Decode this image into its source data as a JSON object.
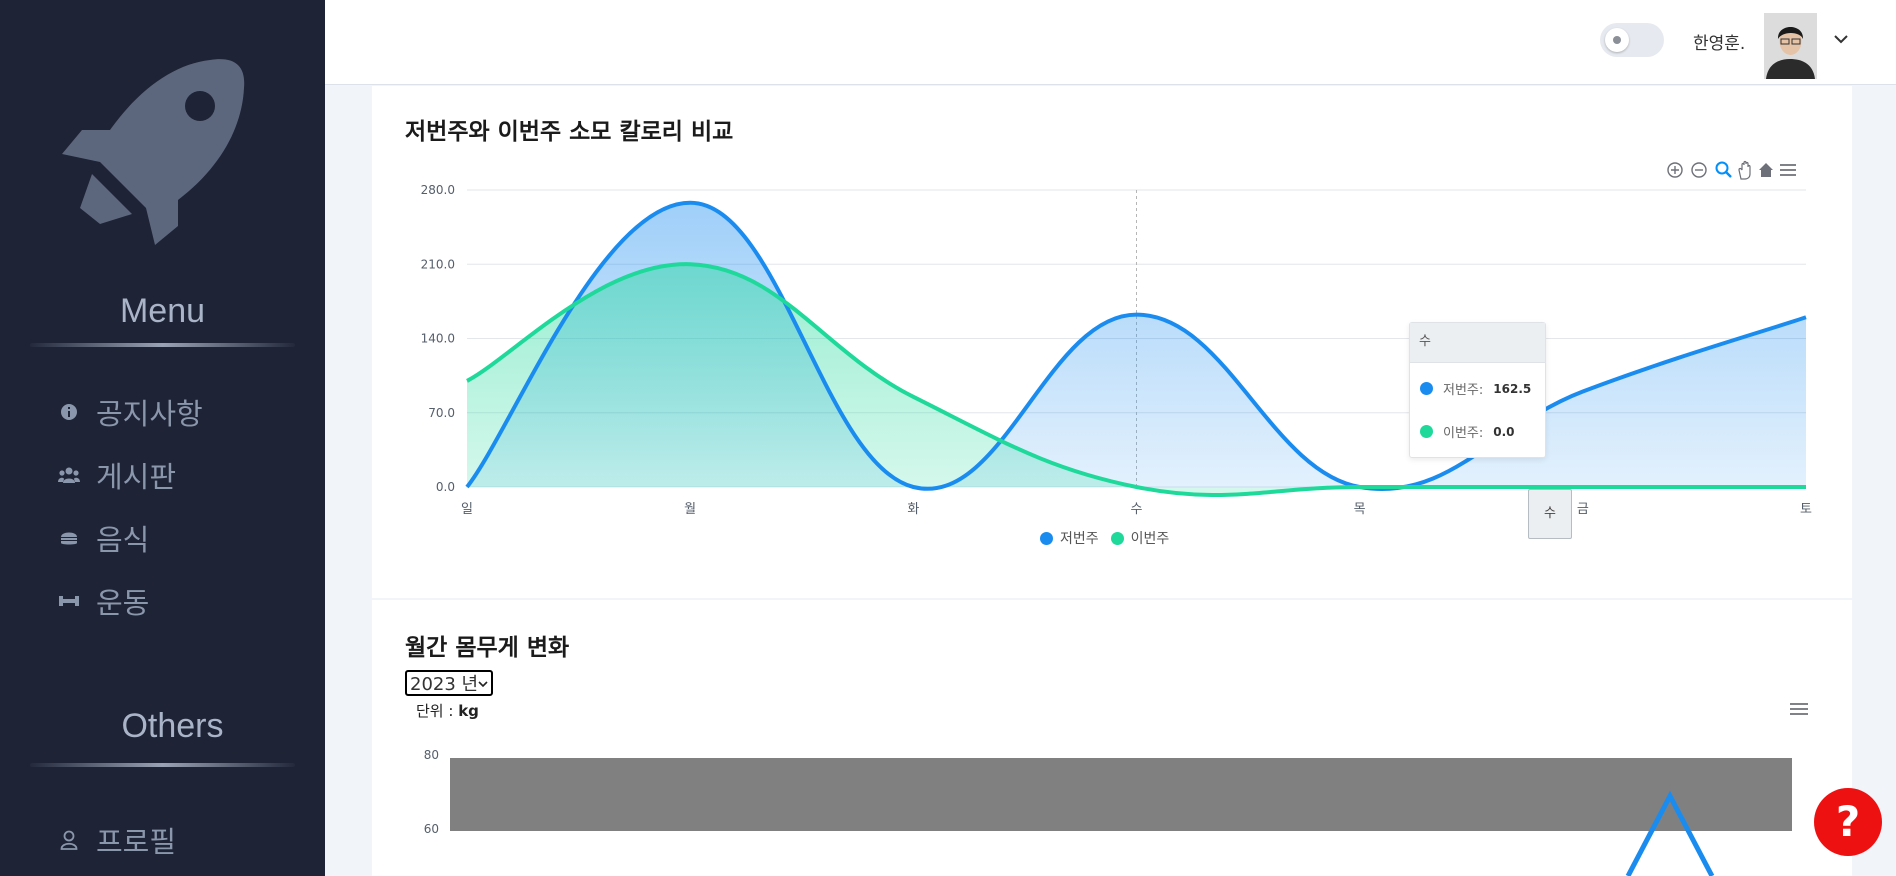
{
  "sidebar": {
    "menu_title": "Menu",
    "items": [
      {
        "label": "공지사항",
        "icon": "info-icon"
      },
      {
        "label": "게시판",
        "icon": "users-icon"
      },
      {
        "label": "음식",
        "icon": "burger-icon"
      },
      {
        "label": "운동",
        "icon": "dumbbell-icon"
      }
    ],
    "others_title": "Others",
    "other_items": [
      {
        "label": "프로필",
        "icon": "user-icon"
      }
    ]
  },
  "header": {
    "username": "한영훈."
  },
  "calorie_card": {
    "title": "저번주와 이번주 소모 칼로리 비교",
    "tooltip": {
      "header": "수",
      "rows": [
        {
          "name": "저번주:",
          "value": "162.5"
        },
        {
          "name": "이번주:",
          "value": "0.0"
        }
      ]
    },
    "crosshair_label": "수"
  },
  "weight_card": {
    "title": "월간 몸무게 변화",
    "year_select": "2023 년",
    "unit_label": "단위 : ",
    "unit_value": "kg"
  },
  "help_button": "?",
  "chart_data": [
    {
      "type": "area",
      "title": "저번주와 이번주 소모 칼로리 비교",
      "categories": [
        "일",
        "월",
        "화",
        "수",
        "목",
        "금",
        "토"
      ],
      "y_ticks": [
        "0.0",
        "70.0",
        "140.0",
        "210.0",
        "280.0"
      ],
      "ylim": [
        0,
        280
      ],
      "series": [
        {
          "name": "저번주",
          "color": "#1a8cf0",
          "values": [
            0,
            268,
            0,
            162.5,
            0,
            90,
            160
          ]
        },
        {
          "name": "이번주",
          "color": "#1ed99a",
          "values": [
            100,
            210,
            85,
            0,
            0,
            0,
            0
          ]
        }
      ],
      "legend": "bottom",
      "grid": true
    },
    {
      "type": "line",
      "title": "월간 몸무게 변화",
      "y_ticks": [
        "60",
        "80"
      ]
    }
  ]
}
